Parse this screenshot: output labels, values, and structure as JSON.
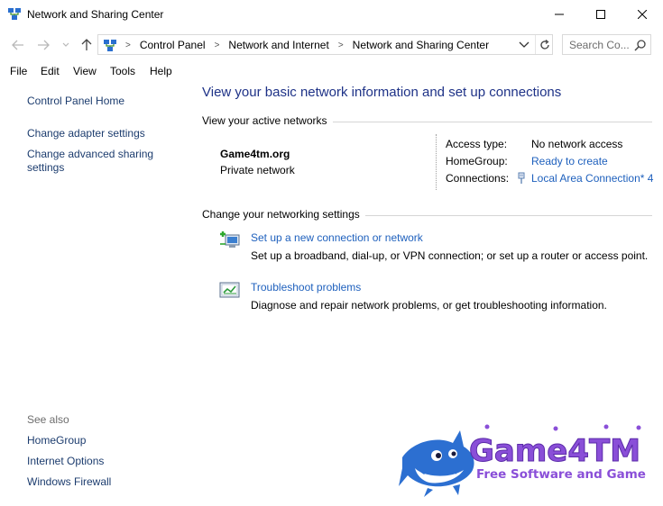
{
  "window": {
    "title": "Network and Sharing Center",
    "minimize_icon": "minimize-icon",
    "maximize_icon": "maximize-icon",
    "close_icon": "close-icon"
  },
  "address_bar": {
    "breadcrumbs": [
      "Control Panel",
      "Network and Internet",
      "Network and Sharing Center"
    ],
    "search_placeholder": "Search Co..."
  },
  "menu": [
    "File",
    "Edit",
    "View",
    "Tools",
    "Help"
  ],
  "left_pane": {
    "home": "Control Panel Home",
    "links": [
      "Change adapter settings",
      "Change advanced sharing settings"
    ],
    "see_also_label": "See also",
    "see_also": [
      "HomeGroup",
      "Internet Options",
      "Windows Firewall"
    ]
  },
  "main": {
    "title": "View your basic network information and set up connections",
    "active_networks_label": "View your active networks",
    "network": {
      "name": "Game4tm.org",
      "type": "Private network",
      "access_type_label": "Access type:",
      "access_type_value": "No network access",
      "homegroup_label": "HomeGroup:",
      "homegroup_value": "Ready to create",
      "connections_label": "Connections:",
      "connections_value": "Local Area Connection* 4"
    },
    "change_settings_label": "Change your networking settings",
    "tasks": [
      {
        "link": "Set up a new connection or network",
        "desc": "Set up a broadband, dial-up, or VPN connection; or set up a router or access point."
      },
      {
        "link": "Troubleshoot problems",
        "desc": "Diagnose and repair network problems, or get troubleshooting information."
      }
    ]
  },
  "watermark": {
    "brand": "Game4TM",
    "tagline": "Free Software and Game"
  },
  "colors": {
    "link": "#1e60bd",
    "title": "#1e3287",
    "nav_link": "#1c3c6e",
    "watermark_purple": "#8a4fd8",
    "watermark_blue": "#2c6fd1"
  }
}
